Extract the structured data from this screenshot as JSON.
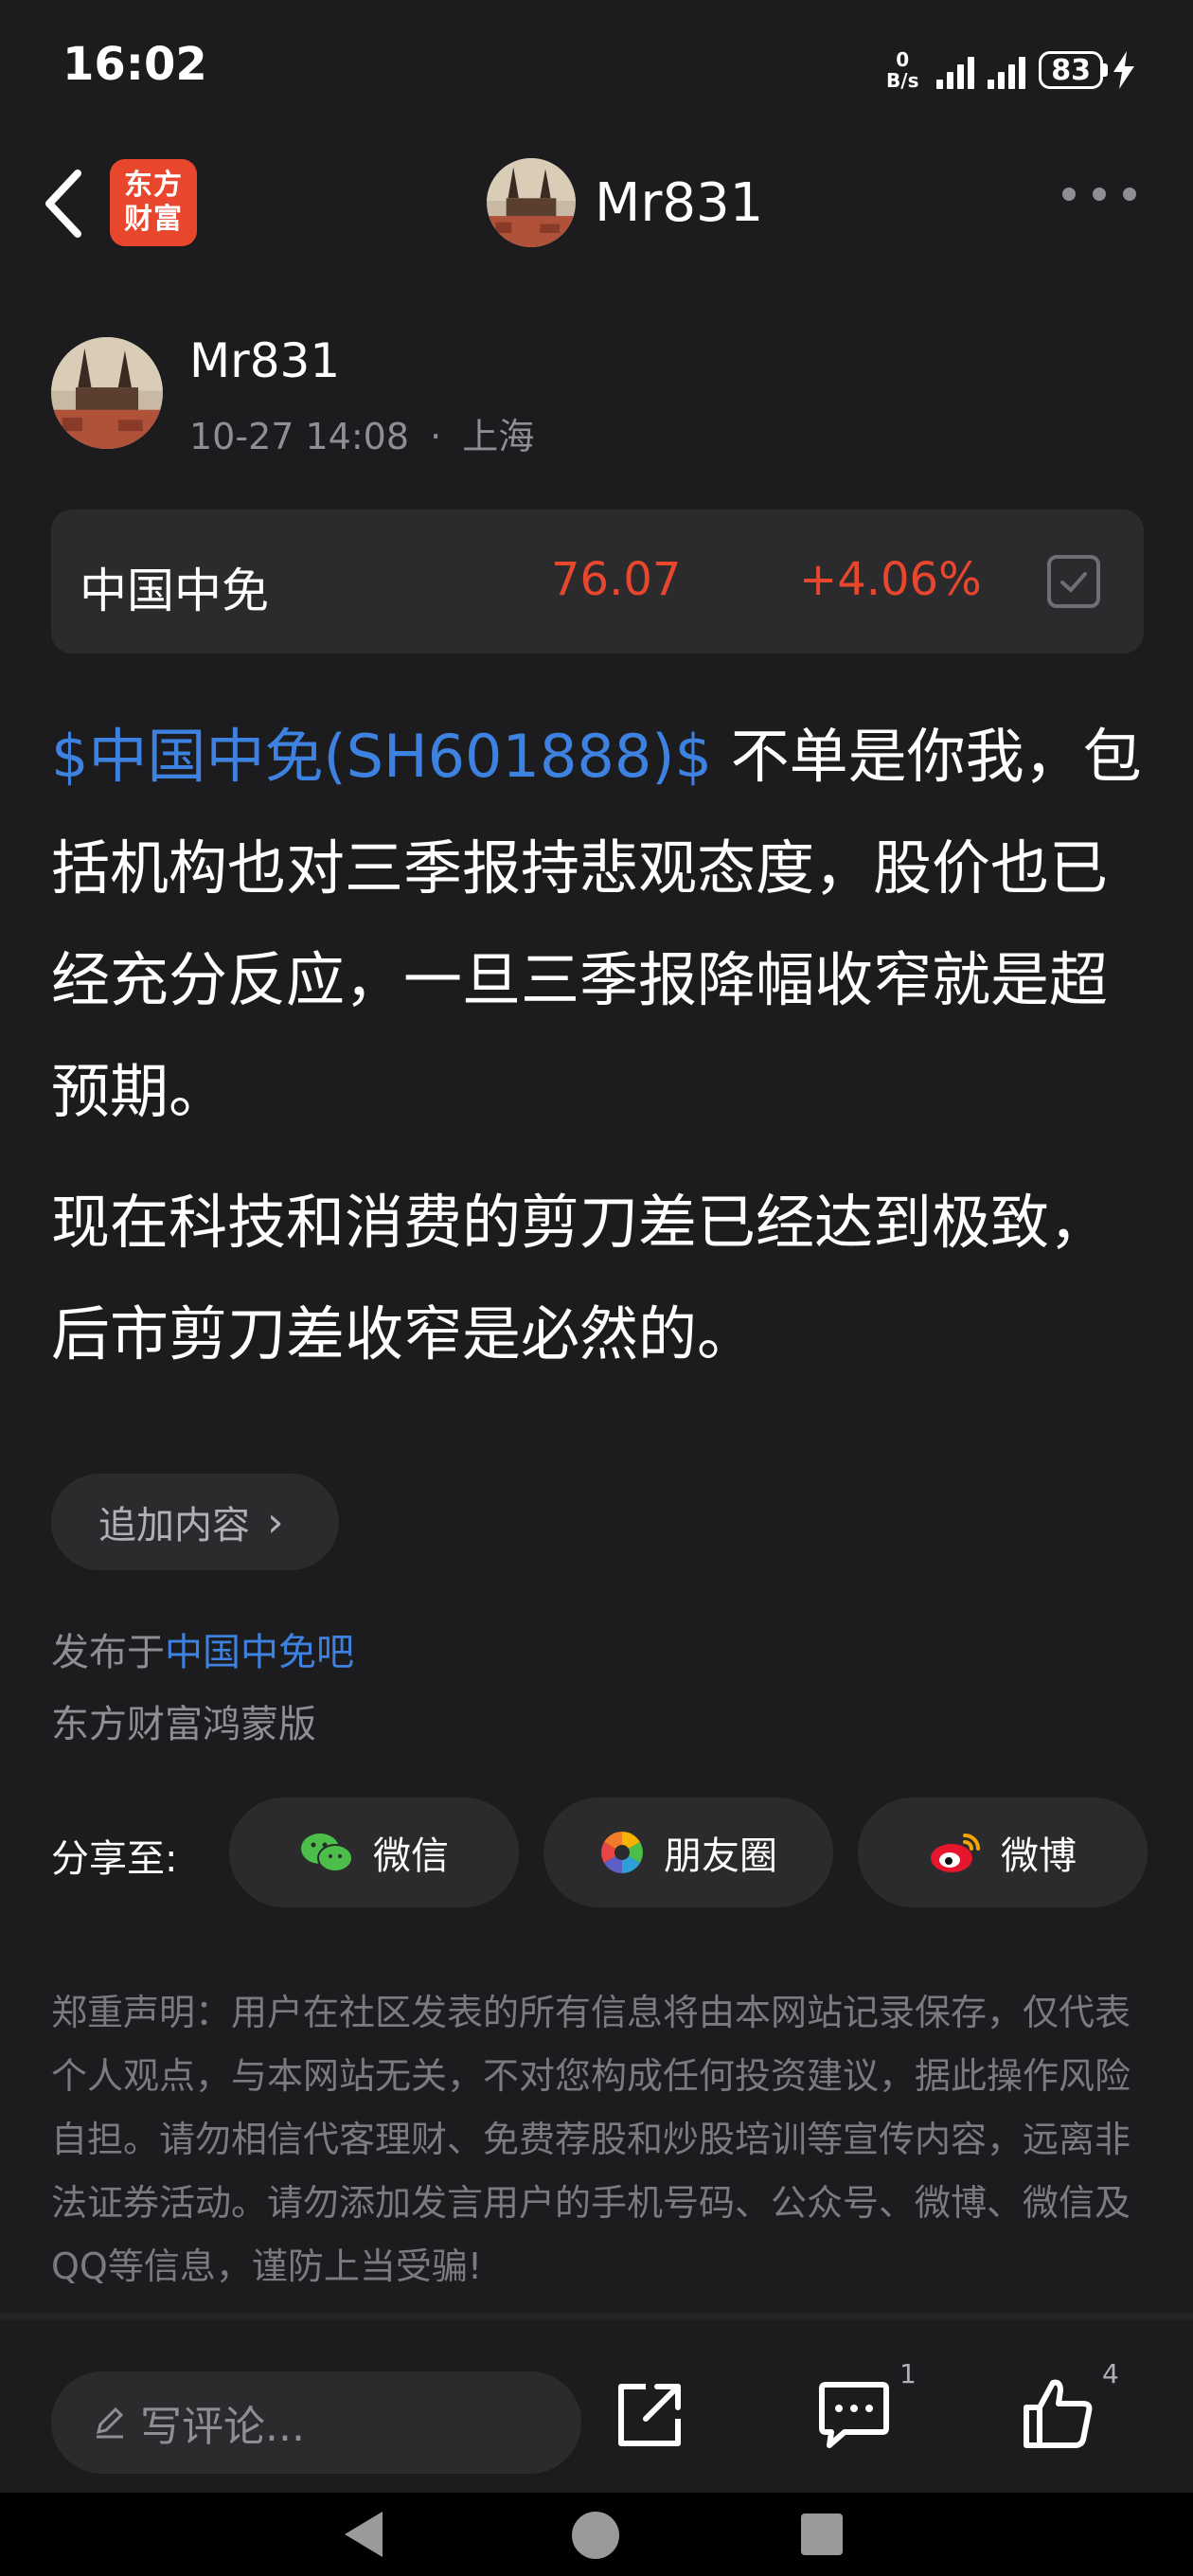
{
  "status_bar": {
    "time": "16:02",
    "net_speed_value": "0",
    "net_speed_unit": "B/s",
    "battery": "83"
  },
  "nav": {
    "logo_line1": "东方",
    "logo_line2": "财富",
    "title": "Mr831",
    "brand_color": "#e8472e"
  },
  "author": {
    "name": "Mr831",
    "time": "10-27 14:08",
    "separator": "·",
    "location": "上海"
  },
  "stock": {
    "name": "中国中免",
    "price": "76.07",
    "change": "+4.06%",
    "up_color": "#e8472e"
  },
  "post": {
    "stock_tag": "$中国中免(SH601888)$",
    "paragraph1_rest": " 不单是你我，包括机构也对三季报持悲观态度，股价也已经充分反应，一旦三季报降幅收窄就是超预期。",
    "paragraph2": "现在科技和消费的剪刀差已经达到极致，后市剪刀差收窄是必然的。",
    "tag_color": "#3d82e0"
  },
  "append_button": {
    "label": "追加内容",
    "chevron": "›"
  },
  "published": {
    "prefix": "发布于",
    "bar_name": "中国中免吧",
    "client": "东方财富鸿蒙版"
  },
  "share": {
    "label": "分享至:",
    "wechat": "微信",
    "moments": "朋友圈",
    "weibo": "微博"
  },
  "disclaimer": "郑重声明：用户在社区发表的所有信息将由本网站记录保存，仅代表个人观点，与本网站无关，不对您构成任何投资建议，据此操作风险自担。请勿相信代客理财、免费荐股和炒股培训等宣传内容，远离非法证券活动。请勿添加发言用户的手机号码、公众号、微博、微信及QQ等信息，谨防上当受骗!",
  "action_bar": {
    "comment_placeholder": "写评论...",
    "comment_count": "1",
    "like_count": "4"
  },
  "icons": {
    "back": "chevron-left-icon",
    "more": "more-dots-icon",
    "share": "share-out-icon",
    "comment": "comment-bubble-icon",
    "like": "thumbs-up-icon",
    "pencil": "pencil-icon",
    "wechat": "wechat-icon",
    "moments": "moments-icon",
    "weibo": "weibo-icon"
  }
}
